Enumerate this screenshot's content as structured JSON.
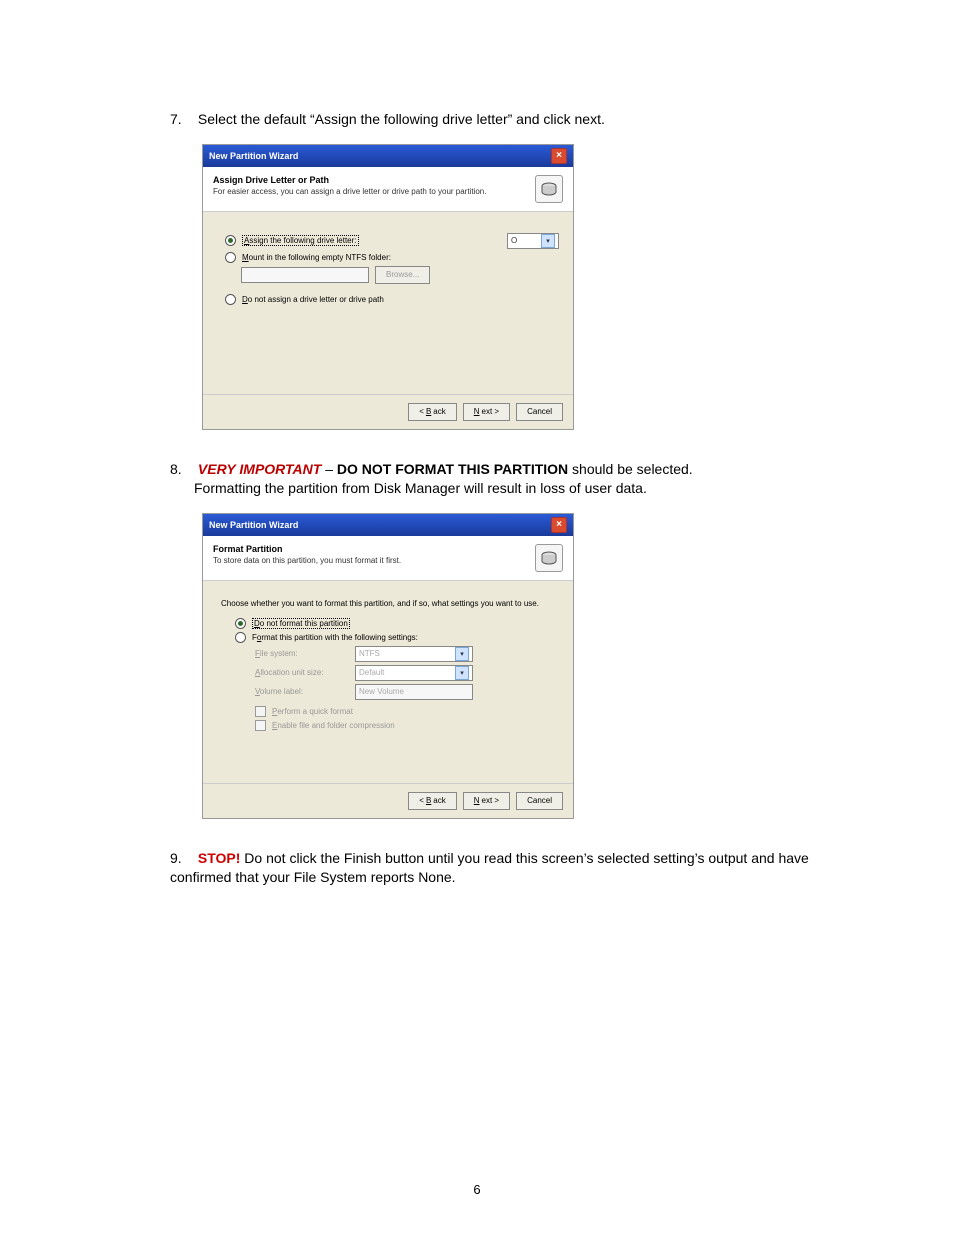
{
  "page_number": "6",
  "steps": {
    "s7": {
      "num": "7.",
      "text": "Select the default “Assign the following drive letter” and click next."
    },
    "s8": {
      "num": "8.",
      "pre": "VERY IMPORTANT",
      "dash": " – ",
      "bold": "DO NOT FORMAT THIS PARTITION",
      "post1": " should be selected.",
      "line2": "Formatting the partition from Disk Manager will result in loss of user data."
    },
    "s9": {
      "num": "9.",
      "pre": "STOP!",
      "post": " Do not click the Finish button until you read this screen’s selected setting’s output and have confirmed that your File System reports None."
    }
  },
  "wiz1": {
    "title": "New Partition Wizard",
    "close": "×",
    "h1": "Assign Drive Letter or Path",
    "h2": "For easier access, you can assign a drive letter or drive path to your partition.",
    "opt_assign": "Assign the following drive letter:",
    "drive_letter": "O",
    "opt_mount": "Mount in the following empty NTFS folder:",
    "browse": "Browse...",
    "opt_none": "Do not assign a drive letter or drive path",
    "back": "< Back",
    "next": "Next >",
    "cancel": "Cancel"
  },
  "wiz2": {
    "title": "New Partition Wizard",
    "close": "×",
    "h1": "Format Partition",
    "h2": "To store data on this partition, you must format it first.",
    "desc": "Choose whether you want to format this partition, and if so, what settings you want to use.",
    "opt_noformat": "Do not format this partition",
    "opt_format": "Format this partition with the following settings:",
    "fs_label": "File system:",
    "fs_val": "NTFS",
    "alloc_label": "Allocation unit size:",
    "alloc_val": "Default",
    "vol_label": "Volume label:",
    "vol_val": "New Volume",
    "quick": "Perform a quick format",
    "compress": "Enable file and folder compression",
    "back": "< Back",
    "next": "Next >",
    "cancel": "Cancel"
  }
}
